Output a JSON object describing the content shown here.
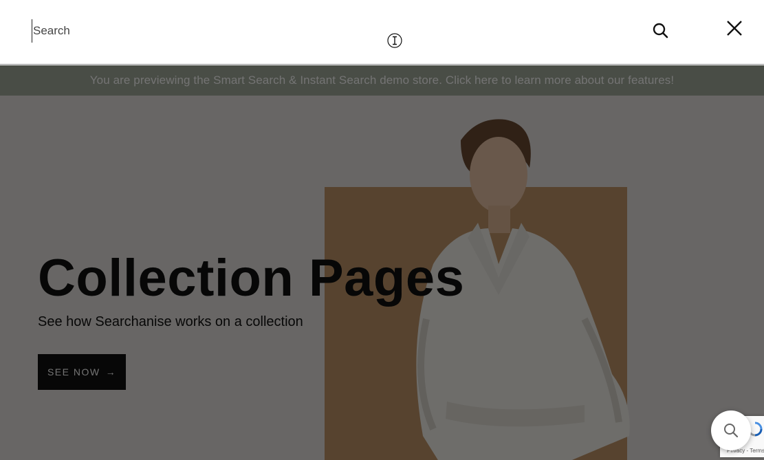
{
  "search": {
    "placeholder": "Search"
  },
  "announcement": {
    "text": "You are previewing the Smart Search & Instant Search demo store. Click here to learn more about our features!"
  },
  "hero": {
    "title": "Collection Pages",
    "subtitle": "See how Searchanise works on a collection",
    "button_label": "SEE NOW",
    "button_arrow": "→"
  },
  "recaptcha": {
    "terms_text": "Privacy - Terms"
  },
  "icons": {
    "search": "search-icon",
    "close": "close-icon",
    "cursor": "text-cursor-icon",
    "arrow": "arrow-right-icon",
    "widget_search": "search-widget-icon",
    "recaptcha": "recaptcha-logo-icon"
  },
  "colors": {
    "announcement_bg": "#a3aa9b",
    "hero_block": "#c29668",
    "button_bg": "#111111",
    "overlay": "rgba(0,0,0,0.55)"
  }
}
